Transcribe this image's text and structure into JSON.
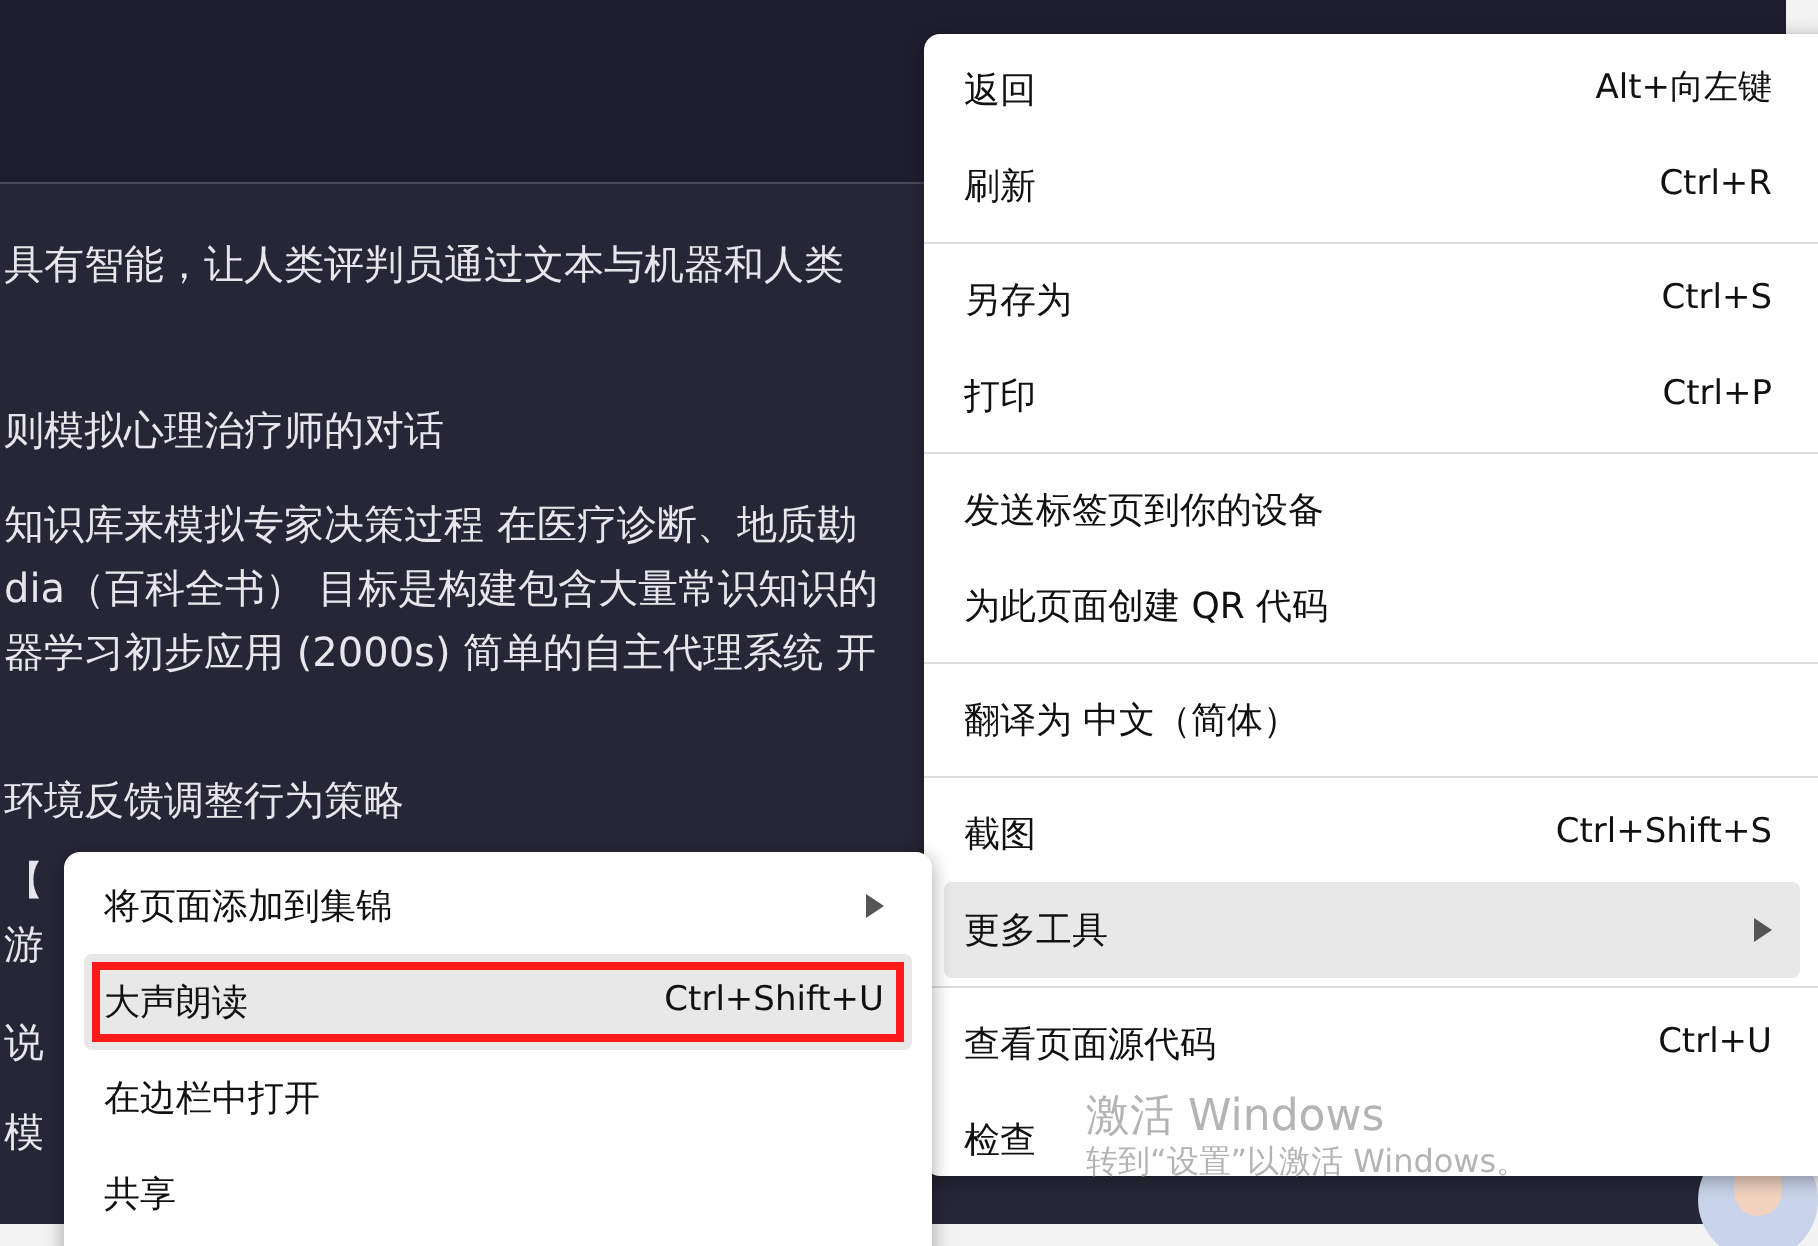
{
  "page": {
    "paragraphs": [
      {
        "lines": [
          "具有智能，让人类评判员通过文本与机器和人类"
        ]
      },
      {
        "lines": [
          "则模拟心理治疗师的对话"
        ]
      },
      {
        "lines": [
          "知识库来模拟专家决策过程 在医疗诊断、地质勘",
          "dia（百科全书） 目标是构建包含大量常识知识的",
          "器学习初步应用 (2000s) 简单的自主代理系统 开"
        ]
      },
      {
        "lines": [
          "环境反馈调整行为策略"
        ]
      },
      {
        "lines": [
          "【",
          "游"
        ]
      },
      {
        "lines": [
          "说",
          "模"
        ]
      }
    ]
  },
  "context_menu": {
    "items": [
      {
        "kind": "item",
        "label": "返回",
        "shortcut": "Alt+向左键",
        "selected": false
      },
      {
        "kind": "item",
        "label": "刷新",
        "shortcut": "Ctrl+R",
        "selected": false
      },
      {
        "kind": "divider"
      },
      {
        "kind": "item",
        "label": "另存为",
        "shortcut": "Ctrl+S",
        "selected": false
      },
      {
        "kind": "item",
        "label": "打印",
        "shortcut": "Ctrl+P",
        "selected": false
      },
      {
        "kind": "divider"
      },
      {
        "kind": "item",
        "label": "发送标签页到你的设备",
        "selected": false
      },
      {
        "kind": "item",
        "label": "为此页面创建 QR 代码",
        "selected": false
      },
      {
        "kind": "divider"
      },
      {
        "kind": "item",
        "label": "翻译为 中文（简体）",
        "selected": false
      },
      {
        "kind": "divider"
      },
      {
        "kind": "item",
        "label": "截图",
        "shortcut": "Ctrl+Shift+S",
        "selected": false
      },
      {
        "kind": "submenu",
        "label": "更多工具",
        "selected": true
      },
      {
        "kind": "divider"
      },
      {
        "kind": "item",
        "label": "查看页面源代码",
        "shortcut": "Ctrl+U",
        "selected": false
      },
      {
        "kind": "item",
        "label": "检查",
        "selected": false
      }
    ]
  },
  "submenu": {
    "items": [
      {
        "kind": "submenu",
        "label": "将页面添加到集锦",
        "selected": false,
        "outlined": false
      },
      {
        "kind": "item",
        "label": "大声朗读",
        "shortcut": "Ctrl+Shift+U",
        "selected": true,
        "outlined": true
      },
      {
        "kind": "item",
        "label": "在边栏中打开",
        "selected": false,
        "outlined": false
      },
      {
        "kind": "item",
        "label": "共享",
        "selected": false,
        "outlined": false
      }
    ]
  },
  "activation_notice": {
    "title": "激活 Windows",
    "message": "转到“设置”以激活 Windows。"
  }
}
